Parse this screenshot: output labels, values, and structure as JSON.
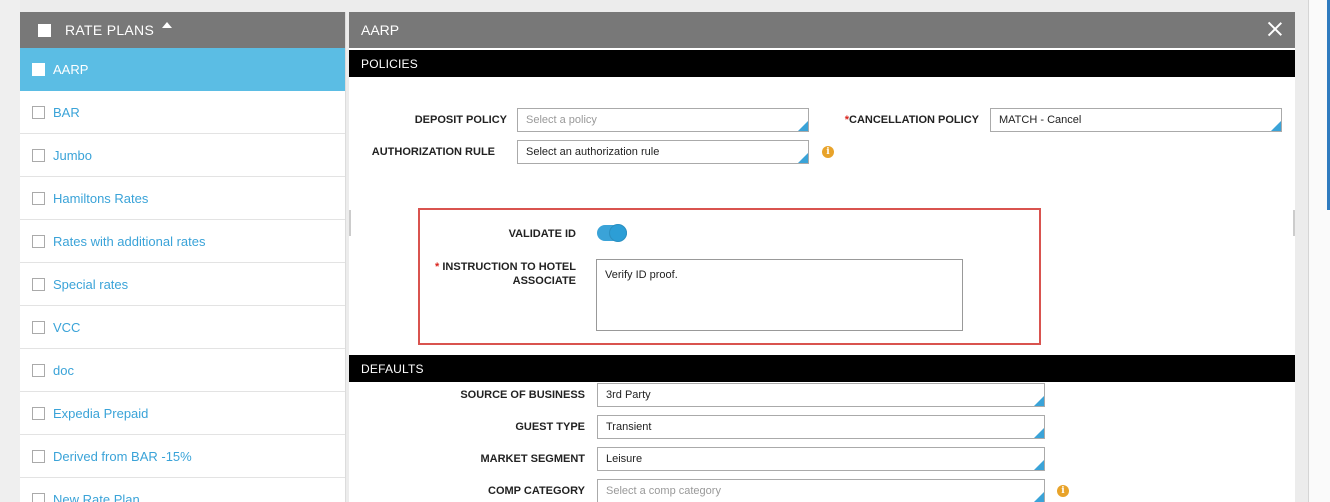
{
  "left_panel": {
    "header_label": "RATE PLANS",
    "items": [
      {
        "label": "AARP",
        "selected": true
      },
      {
        "label": "BAR",
        "selected": false
      },
      {
        "label": "Jumbo",
        "selected": false
      },
      {
        "label": "Hamiltons Rates",
        "selected": false
      },
      {
        "label": "Rates with additional rates",
        "selected": false
      },
      {
        "label": "Special rates",
        "selected": false
      },
      {
        "label": "VCC",
        "selected": false
      },
      {
        "label": "doc",
        "selected": false
      },
      {
        "label": "Expedia Prepaid",
        "selected": false
      },
      {
        "label": "Derived from BAR -15%",
        "selected": false
      },
      {
        "label": "New Rate Plan",
        "selected": false
      }
    ]
  },
  "right_panel": {
    "title": "AARP",
    "policies": {
      "section_label": "POLICIES",
      "deposit_policy": {
        "label": "DEPOSIT POLICY",
        "placeholder": "Select a policy"
      },
      "cancellation_policy": {
        "required_mark": "*",
        "label": "CANCELLATION POLICY",
        "value": "MATCH - Cancel"
      },
      "authorization_rule": {
        "label": "AUTHORIZATION RULE",
        "value": "Select an authorization rule"
      },
      "info_glyph": "i"
    },
    "validate_id": {
      "label": "VALIDATE ID",
      "enabled": true
    },
    "instruction": {
      "required_mark": "* ",
      "label_line1": "INSTRUCTION TO HOTEL",
      "label_line2": "ASSOCIATE",
      "value": "Verify ID proof."
    },
    "defaults": {
      "section_label": "DEFAULTS",
      "source_of_business": {
        "label": "SOURCE OF BUSINESS",
        "value": "3rd Party"
      },
      "guest_type": {
        "label": "GUEST TYPE",
        "value": "Transient"
      },
      "market_segment": {
        "label": "MARKET SEGMENT",
        "value": "Leisure"
      },
      "comp_category": {
        "label": "COMP CATEGORY",
        "placeholder": "Select a comp category"
      }
    }
  },
  "colors": {
    "header_gray": "#787878",
    "accent_blue": "#3aa3d8",
    "selected_blue": "#5bbde4",
    "highlight_red": "#d9534f",
    "info_orange": "#e8a32a"
  }
}
